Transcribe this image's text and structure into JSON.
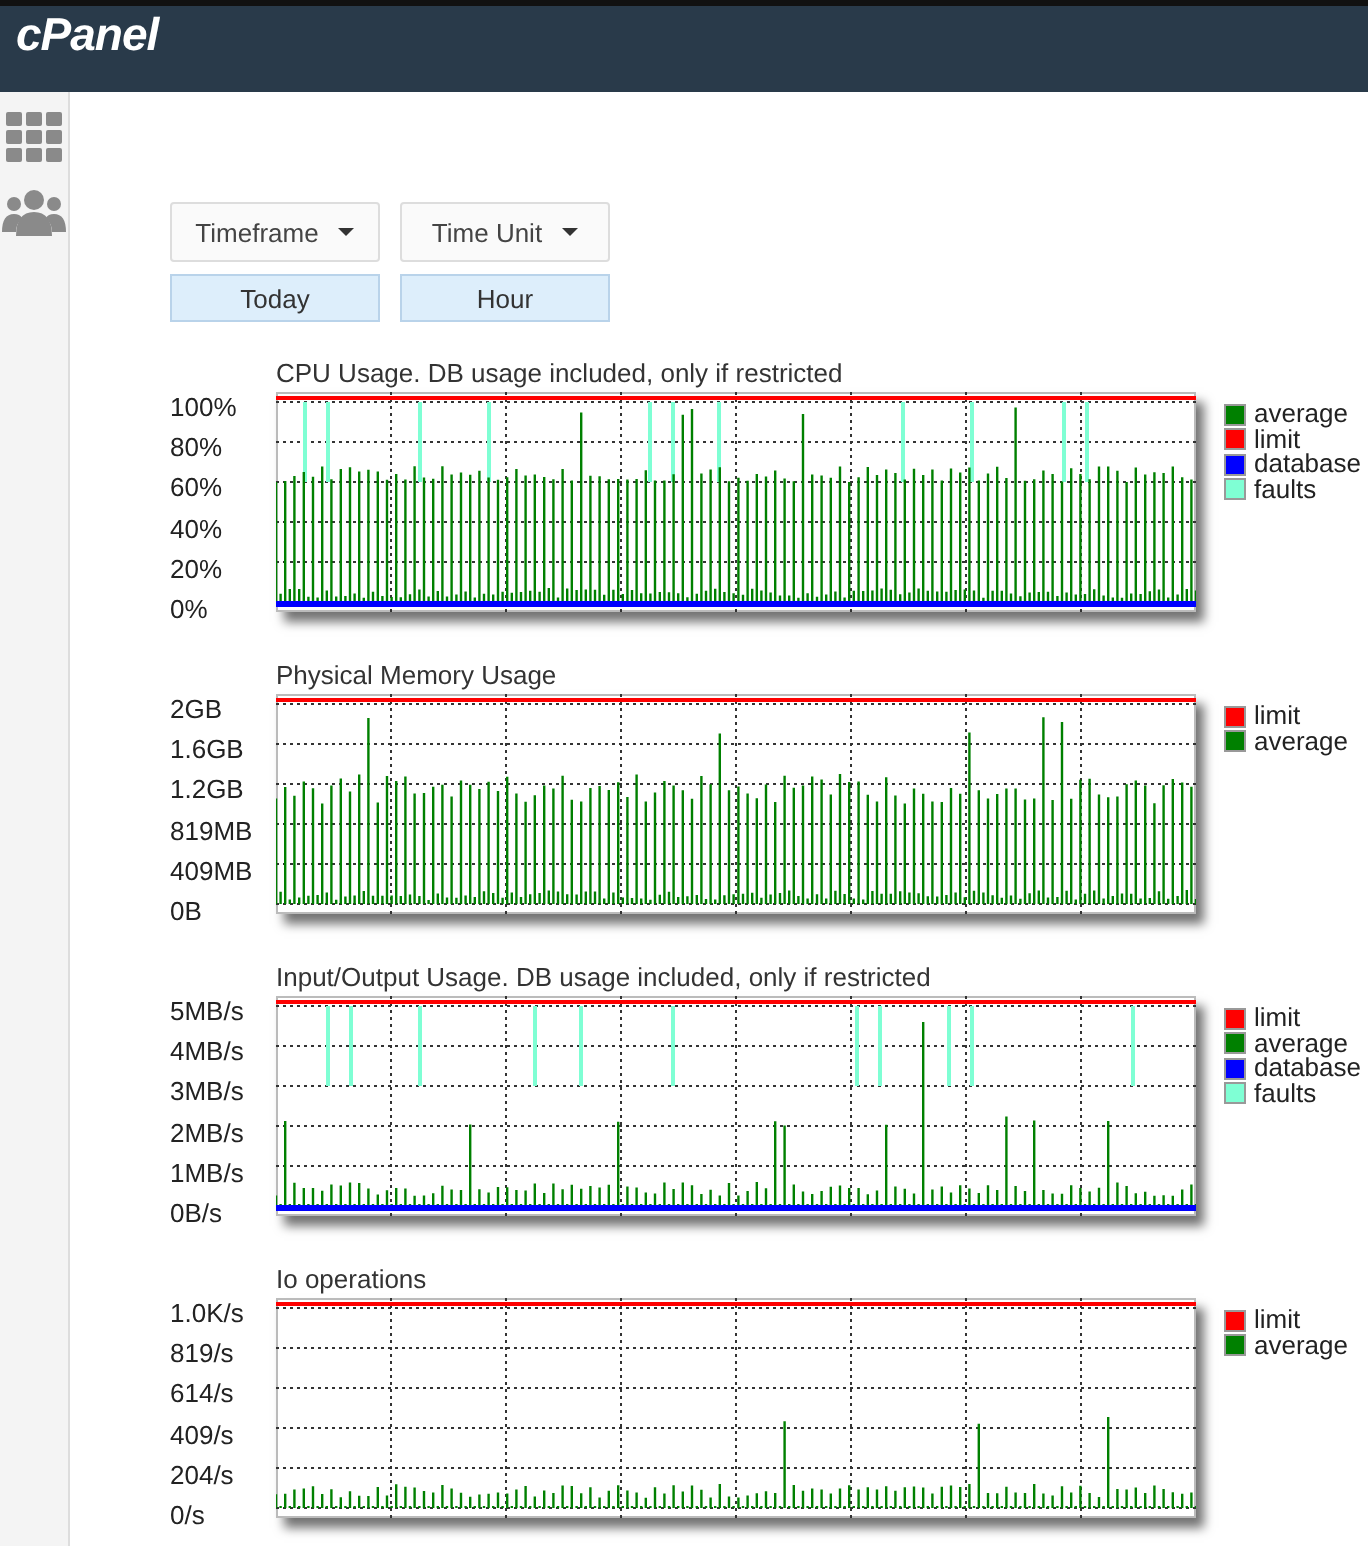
{
  "header": {
    "logo": "cPanel"
  },
  "filters": [
    {
      "label": "Timeframe",
      "value": "Today"
    },
    {
      "label": "Time Unit",
      "value": "Hour"
    }
  ],
  "charts": [
    {
      "title": "CPU Usage. DB usage included, only if restricted",
      "yaxis": [
        "100%",
        "80%",
        "60%",
        "40%",
        "20%",
        "0%"
      ],
      "legend": [
        {
          "label": "average",
          "color": "#008000",
          "kind": "average"
        },
        {
          "label": "limit",
          "color": "#ff0000",
          "kind": "limit"
        },
        {
          "label": "database",
          "color": "#0000ff",
          "kind": "database"
        },
        {
          "label": "faults",
          "color": "#7fffd4",
          "kind": "faults"
        }
      ]
    },
    {
      "title": "Physical Memory Usage",
      "yaxis": [
        "2GB",
        "1.6GB",
        "1.2GB",
        "819MB",
        "409MB",
        "0B"
      ],
      "legend": [
        {
          "label": "limit",
          "color": "#ff0000",
          "kind": "limit"
        },
        {
          "label": "average",
          "color": "#008000",
          "kind": "average"
        }
      ]
    },
    {
      "title": "Input/Output Usage. DB usage included, only if restricted",
      "yaxis": [
        "5MB/s",
        "4MB/s",
        "3MB/s",
        "2MB/s",
        "1MB/s",
        "0B/s"
      ],
      "legend": [
        {
          "label": "limit",
          "color": "#ff0000",
          "kind": "limit"
        },
        {
          "label": "average",
          "color": "#008000",
          "kind": "average"
        },
        {
          "label": "database",
          "color": "#0000ff",
          "kind": "database"
        },
        {
          "label": "faults",
          "color": "#7fffd4",
          "kind": "faults"
        }
      ]
    },
    {
      "title": "Io operations",
      "yaxis": [
        "1.0K/s",
        "819/s",
        "614/s",
        "409/s",
        "204/s",
        "0/s"
      ],
      "legend": [
        {
          "label": "limit",
          "color": "#ff0000",
          "kind": "limit"
        },
        {
          "label": "average",
          "color": "#008000",
          "kind": "average"
        }
      ]
    }
  ]
}
